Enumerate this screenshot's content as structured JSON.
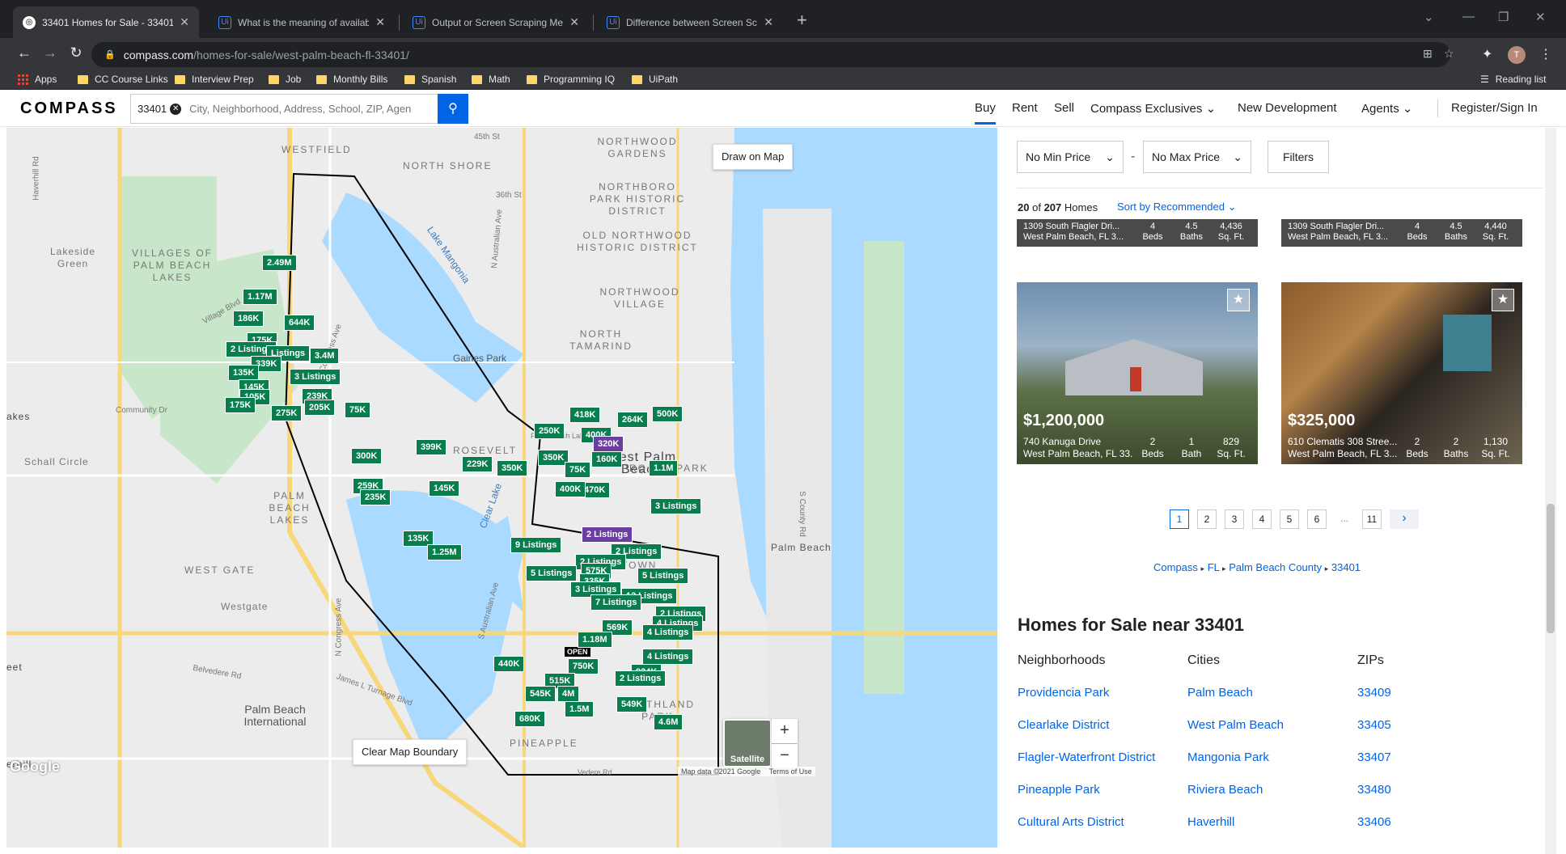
{
  "tabs": [
    {
      "title": "33401 Homes for Sale - 33401 Re",
      "active": true
    },
    {
      "title": "What is the meaning of available",
      "active": false
    },
    {
      "title": "Output or Screen Scraping Meth",
      "active": false
    },
    {
      "title": "Difference between Screen Scrap",
      "active": false
    }
  ],
  "url": {
    "domain": "compass.com",
    "path": "/homes-for-sale/west-palm-beach-fl-33401/"
  },
  "bookmarks": [
    "Apps",
    "CC Course Links",
    "Interview Prep",
    "Job",
    "Monthly Bills",
    "Spanish",
    "Math",
    "Programming IQ",
    "UiPath",
    "Reading list"
  ],
  "profile_initial": "T",
  "header": {
    "logo": "COMPASS",
    "search_chip": "33401",
    "search_placeholder": "City, Neighborhood, Address, School, ZIP, Agen",
    "nav": [
      "Buy",
      "Rent",
      "Sell",
      "Compass Exclusives",
      "New Development",
      "Agents",
      "Register/Sign In"
    ]
  },
  "map": {
    "draw_button": "Draw on Map",
    "clear_button": "Clear Map Boundary",
    "satellite": "Satellite",
    "zoom_in": "+",
    "zoom_out": "−",
    "attribution": "Map data ©2021 Google",
    "terms": "Terms of Use",
    "google": "Google",
    "labels": [
      "WESTFIELD",
      "NORTH SHORE",
      "NORTHWOOD GARDENS",
      "NORTHBORO PARK HISTORIC DISTRICT",
      "OLD NORTHWOOD HISTORIC DISTRICT",
      "NORTHWOOD VILLAGE",
      "NORTH TAMARIND",
      "VILLAGES OF PALM BEACH LAKES",
      "Lakeside Green",
      "Schall Circle",
      "PALM BEACH LAKES",
      "WEST GATE",
      "Westgate",
      "Gaines Park",
      "West Palm Beach",
      "Palm Beach",
      "SOUTHLAND PARK",
      "Lake Mangonia",
      "Clear Lake",
      "Palm Beach International",
      "Community Dr",
      "Belvedere Rd",
      "James L Turnage Blvd",
      "S County Rd",
      "Village Blvd",
      "Haverhill Rd",
      "N Congress Ave",
      "Congress Ave",
      "45th St",
      "36th St",
      "N Australian Ave",
      "S Australian Ave",
      "Palm Beach Lake",
      "Vedere Rd",
      "ROSEVELT",
      "PRO CIA PARK",
      "PINEAPPLE",
      "TOWN",
      "OPEN",
      "erhill",
      "eet",
      "akes"
    ],
    "pins": [
      "2.49M",
      "1.17M",
      "186K",
      "644K",
      "175K",
      "2 Listings",
      "Listings",
      "3.4M",
      "339K",
      "135K",
      "3 Listings",
      "145K",
      "105K",
      "239K",
      "175K",
      "205K",
      "75K",
      "275K",
      "418K",
      "250K",
      "264K",
      "500K",
      "400K",
      "320K",
      "350K",
      "160K",
      "300K",
      "399K",
      "229K",
      "350K",
      "75K",
      "1.1M",
      "470K",
      "259K",
      "235K",
      "145K",
      "400K",
      "3 Listings",
      "2 Listings",
      "9 Listings",
      "135K",
      "1.25M",
      "2 Listings",
      "2 Listings",
      "575K",
      "5 Listings",
      "5 Listings",
      "335K",
      "3 Listings",
      "13 Listings",
      "7 Listings",
      "2 Listings",
      "4 Listings",
      "569K",
      "1.18M",
      "4 Listings",
      "440K",
      "750K",
      "4 Listings",
      "515K",
      "924K",
      "545K",
      "4M",
      "2 Listings",
      "1.5M",
      "549K",
      "680K",
      "4.6M"
    ]
  },
  "filters": {
    "min_price": "No Min Price",
    "max_price": "No Max Price",
    "filters_button": "Filters"
  },
  "results": {
    "shown": "20",
    "of": "of",
    "total": "207",
    "unit": "Homes",
    "sort": "Sort by Recommended"
  },
  "top_cards": [
    {
      "address": "1309 South Flagler Dri...",
      "city": "West Palm Beach, FL 3...",
      "beds": "4",
      "beds_label": "Beds",
      "baths": "4.5",
      "baths_label": "Baths",
      "sqft": "4,436",
      "sqft_label": "Sq. Ft."
    },
    {
      "address": "1309 South Flagler Dri...",
      "city": "West Palm Beach, FL 3...",
      "beds": "4",
      "beds_label": "Beds",
      "baths": "4.5",
      "baths_label": "Baths",
      "sqft": "4,440",
      "sqft_label": "Sq. Ft."
    }
  ],
  "cards": [
    {
      "price": "$1,200,000",
      "address": "740 Kanuga Drive",
      "city": "West Palm Beach, FL 33...",
      "beds": "2",
      "beds_label": "Beds",
      "baths": "1",
      "baths_label": "Bath",
      "sqft": "829",
      "sqft_label": "Sq. Ft."
    },
    {
      "price": "$325,000",
      "address": "610 Clematis 308 Stree...",
      "city": "West Palm Beach, FL 3...",
      "beds": "2",
      "beds_label": "Beds",
      "baths": "2",
      "baths_label": "Baths",
      "sqft": "1,130",
      "sqft_label": "Sq. Ft."
    }
  ],
  "pagination": [
    "1",
    "2",
    "3",
    "4",
    "5",
    "6",
    "...",
    "11"
  ],
  "current_page": "1",
  "breadcrumb": [
    "Compass",
    "FL",
    "Palm Beach County",
    "33401"
  ],
  "near": {
    "title": "Homes for Sale near 33401",
    "columns": [
      {
        "heading": "Neighborhoods",
        "items": [
          "Providencia Park",
          "Clearlake District",
          "Flagler-Waterfront District",
          "Pineapple Park",
          "Cultural Arts District"
        ]
      },
      {
        "heading": "Cities",
        "items": [
          "Palm Beach",
          "West Palm Beach",
          "Mangonia Park",
          "Riviera Beach",
          "Haverhill"
        ]
      },
      {
        "heading": "ZIPs",
        "items": [
          "33409",
          "33405",
          "33407",
          "33480",
          "33406"
        ]
      }
    ]
  }
}
